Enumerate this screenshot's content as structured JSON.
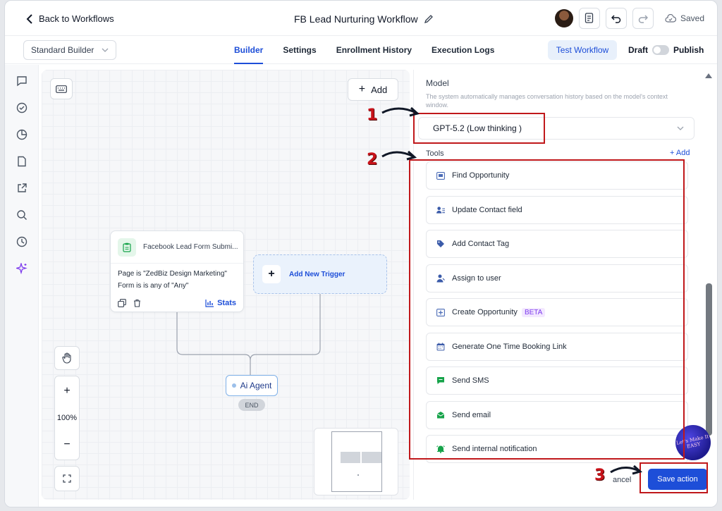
{
  "header": {
    "back_label": "Back to Workflows",
    "title": "FB Lead Nurturing Workflow",
    "saved_label": "Saved"
  },
  "nav": {
    "builder_select": "Standard Builder",
    "tabs": [
      {
        "label": "Builder",
        "active": true
      },
      {
        "label": "Settings",
        "active": false
      },
      {
        "label": "Enrollment History",
        "active": false
      },
      {
        "label": "Execution Logs",
        "active": false
      }
    ],
    "test_workflow": "Test Workflow",
    "draft": "Draft",
    "publish": "Publish"
  },
  "canvas": {
    "add_label": "Add",
    "trigger": {
      "title": "Facebook Lead Form Submi...",
      "line1": "Page is \"ZedBiz Design Marketing\"",
      "line2": "Form is is any of \"Any\"",
      "stats": "Stats"
    },
    "new_trigger": "Add New Trigger",
    "ai_node": "Ai Agent",
    "end": "END",
    "zoom": "100%"
  },
  "panel": {
    "model_label": "Model",
    "model_desc": "The system automatically manages conversation history based on the model's context window.",
    "model_value": "GPT-5.2 (Low thinking )",
    "tools_label": "Tools",
    "tools_add": "+ Add",
    "tools": [
      {
        "label": "Find Opportunity",
        "icon": "opportunity-icon",
        "color": "#4b6cb7"
      },
      {
        "label": "Update Contact field",
        "icon": "contact-field-icon",
        "color": "#3b5ba9"
      },
      {
        "label": "Add Contact Tag",
        "icon": "tag-icon",
        "color": "#3b5ba9"
      },
      {
        "label": "Assign to user",
        "icon": "user-assign-icon",
        "color": "#3b5ba9"
      },
      {
        "label": "Create Opportunity",
        "icon": "opportunity-icon",
        "color": "#4b6cb7",
        "badge": "BETA"
      },
      {
        "label": "Generate One Time Booking Link",
        "icon": "calendar-icon",
        "color": "#3b5ba9"
      },
      {
        "label": "Send SMS",
        "icon": "sms-icon",
        "color": "#16a34a"
      },
      {
        "label": "Send email",
        "icon": "email-icon",
        "color": "#16a34a"
      },
      {
        "label": "Send internal notification",
        "icon": "bell-icon",
        "color": "#16a34a"
      }
    ],
    "cancel": "ancel",
    "save_action": "Save action"
  },
  "annotations": {
    "step1": "1",
    "step2": "2",
    "step3": "3",
    "color": "#c0181b"
  },
  "watermark": "Let's Make It EASY"
}
